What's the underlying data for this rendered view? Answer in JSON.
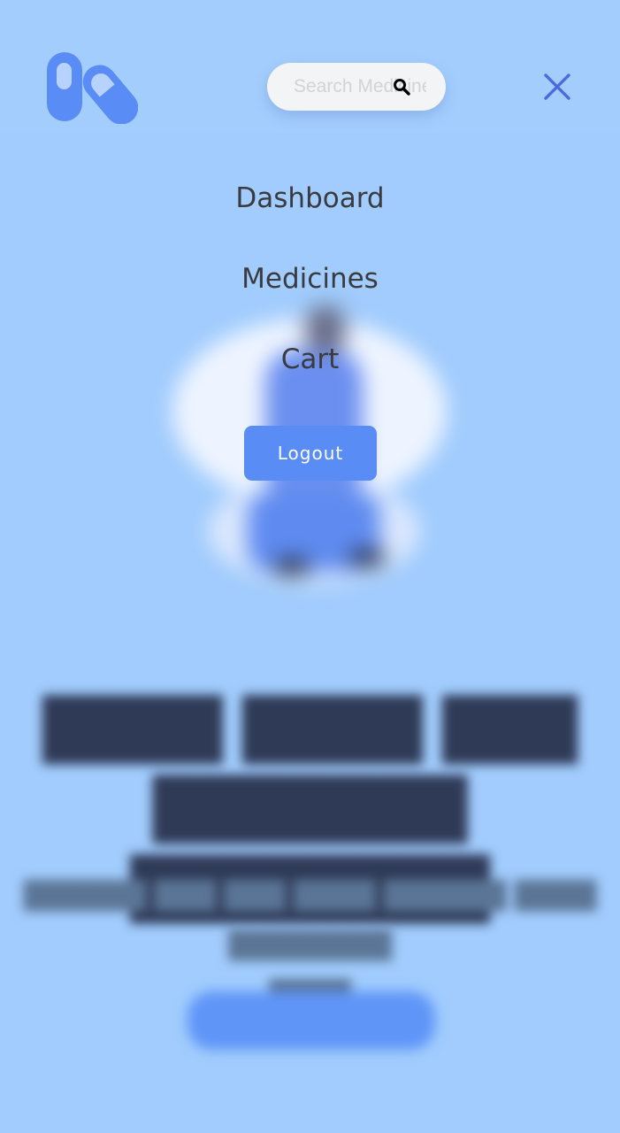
{
  "brand": {
    "logo_icon": "pills-icon",
    "accent_color": "#5a8cf6"
  },
  "header": {
    "search_placeholder": "Search Medicine",
    "search_icon": "search-icon",
    "close_icon": "close-icon"
  },
  "menu": {
    "items": [
      {
        "label": "Dashboard"
      },
      {
        "label": "Medicines"
      },
      {
        "label": "Cart"
      }
    ],
    "logout_label": "Logout"
  }
}
